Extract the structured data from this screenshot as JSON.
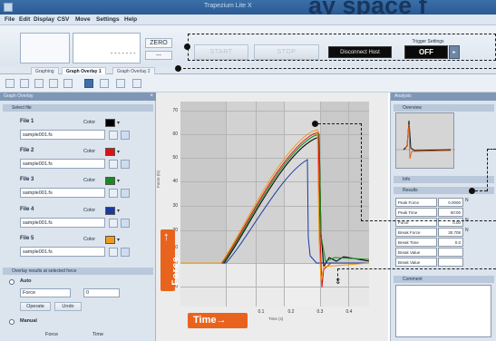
{
  "window": {
    "title": "Trapezium Lite X",
    "banner": "ay space f"
  },
  "menu": [
    "File",
    "Edit",
    "Display",
    "CSV",
    "Move",
    "Settings",
    "Help"
  ],
  "controls": {
    "value_display": "-------",
    "zero_label": "ZERO",
    "small_label": "---",
    "start_label": "START",
    "stop_label": "STOP",
    "disconnect_label": "Disconnect Host",
    "trigger_label": "Trigger Settings",
    "off_label": "OFF"
  },
  "tabs": [
    "Graphing",
    "Graph Overlay 1",
    "Graph Overlay 2"
  ],
  "left_panel": {
    "header": "Graph Overlay",
    "section_files": "Select file",
    "color_label": "Color",
    "files": [
      {
        "label": "File 1",
        "filename": "sample001.fs",
        "color": "#000000"
      },
      {
        "label": "File 2",
        "filename": "sample001.fs",
        "color": "#e01010"
      },
      {
        "label": "File 3",
        "filename": "sample001.fs",
        "color": "#1a8a20"
      },
      {
        "label": "File 4",
        "filename": "sample001.fs",
        "color": "#1a3aa0"
      },
      {
        "label": "File 5",
        "filename": "sample001.fs",
        "color": "#f09a18"
      }
    ],
    "section_sync": "Overlay results at selected force",
    "auto_label": "Auto",
    "force_select": "Force",
    "force_value": "0",
    "operate_label": "Operate",
    "undo_label": "Undo",
    "manual_label": "Manual",
    "force_col": "Force",
    "time_col": "Time"
  },
  "badges": {
    "force": "Force",
    "time": "Time"
  },
  "chart_data": {
    "type": "line",
    "xlabel": "Time (s)",
    "ylabel": "Force (N)",
    "y_ticks": [
      "70",
      "60",
      "50",
      "40",
      "30",
      "20",
      "10",
      "0",
      "-10"
    ],
    "x_ticks": [
      "0.1",
      "0.2",
      "0.3",
      "0.4"
    ],
    "series_colors": [
      "#000000",
      "#e01010",
      "#1a8a20",
      "#1a3aa0",
      "#f09a18"
    ]
  },
  "right_panel": {
    "header": "Analysis",
    "section_overview": "Overview",
    "section_info": "Info",
    "section_results": "Results",
    "results": [
      {
        "name": "Peak Force",
        "value": "0.0000",
        "unit": "N"
      },
      {
        "name": "Peak Time",
        "value": "00:00",
        "unit": ""
      },
      {
        "name": "Force",
        "value": "0.00",
        "unit": "N"
      },
      {
        "name": "Break Force",
        "value": "30.708",
        "unit": "N"
      },
      {
        "name": "Break Time",
        "value": "0.0",
        "unit": ""
      },
      {
        "name": "Break Value",
        "value": "",
        "unit": ""
      },
      {
        "name": "Break Value",
        "value": "",
        "unit": ""
      }
    ],
    "section_comment": "Comment"
  }
}
